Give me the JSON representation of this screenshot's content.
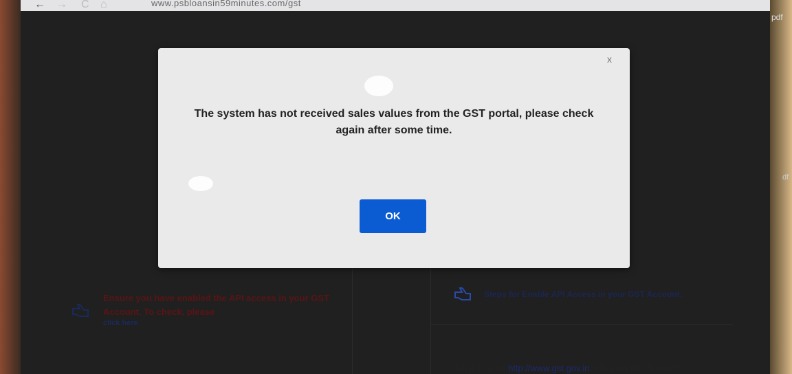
{
  "browser": {
    "url": "www.psbloansin59minutes.com/gst",
    "back_icon": "←",
    "forward_icon": "→",
    "reload_icon": "C",
    "home_icon": "⌂"
  },
  "right_edge_labels": [
    "pdf",
    "df"
  ],
  "dialog": {
    "close_label": "x",
    "message": "The system has not received sales values from the GST portal, please check again after some time.",
    "ok_label": "OK",
    "ok_color": "#0b5bd3"
  },
  "background_page": {
    "notice": "Ensure you have enabled the API access in your GST Account. To check, please",
    "notice_link": "click here",
    "steps_title": "Steps for Enable API Access in your GST Account.",
    "step1_prefix": "Step 1. Visit ",
    "step1_link": "http://www.gst.gov.in",
    "step1_suffix": ", click on the \"Login\""
  }
}
